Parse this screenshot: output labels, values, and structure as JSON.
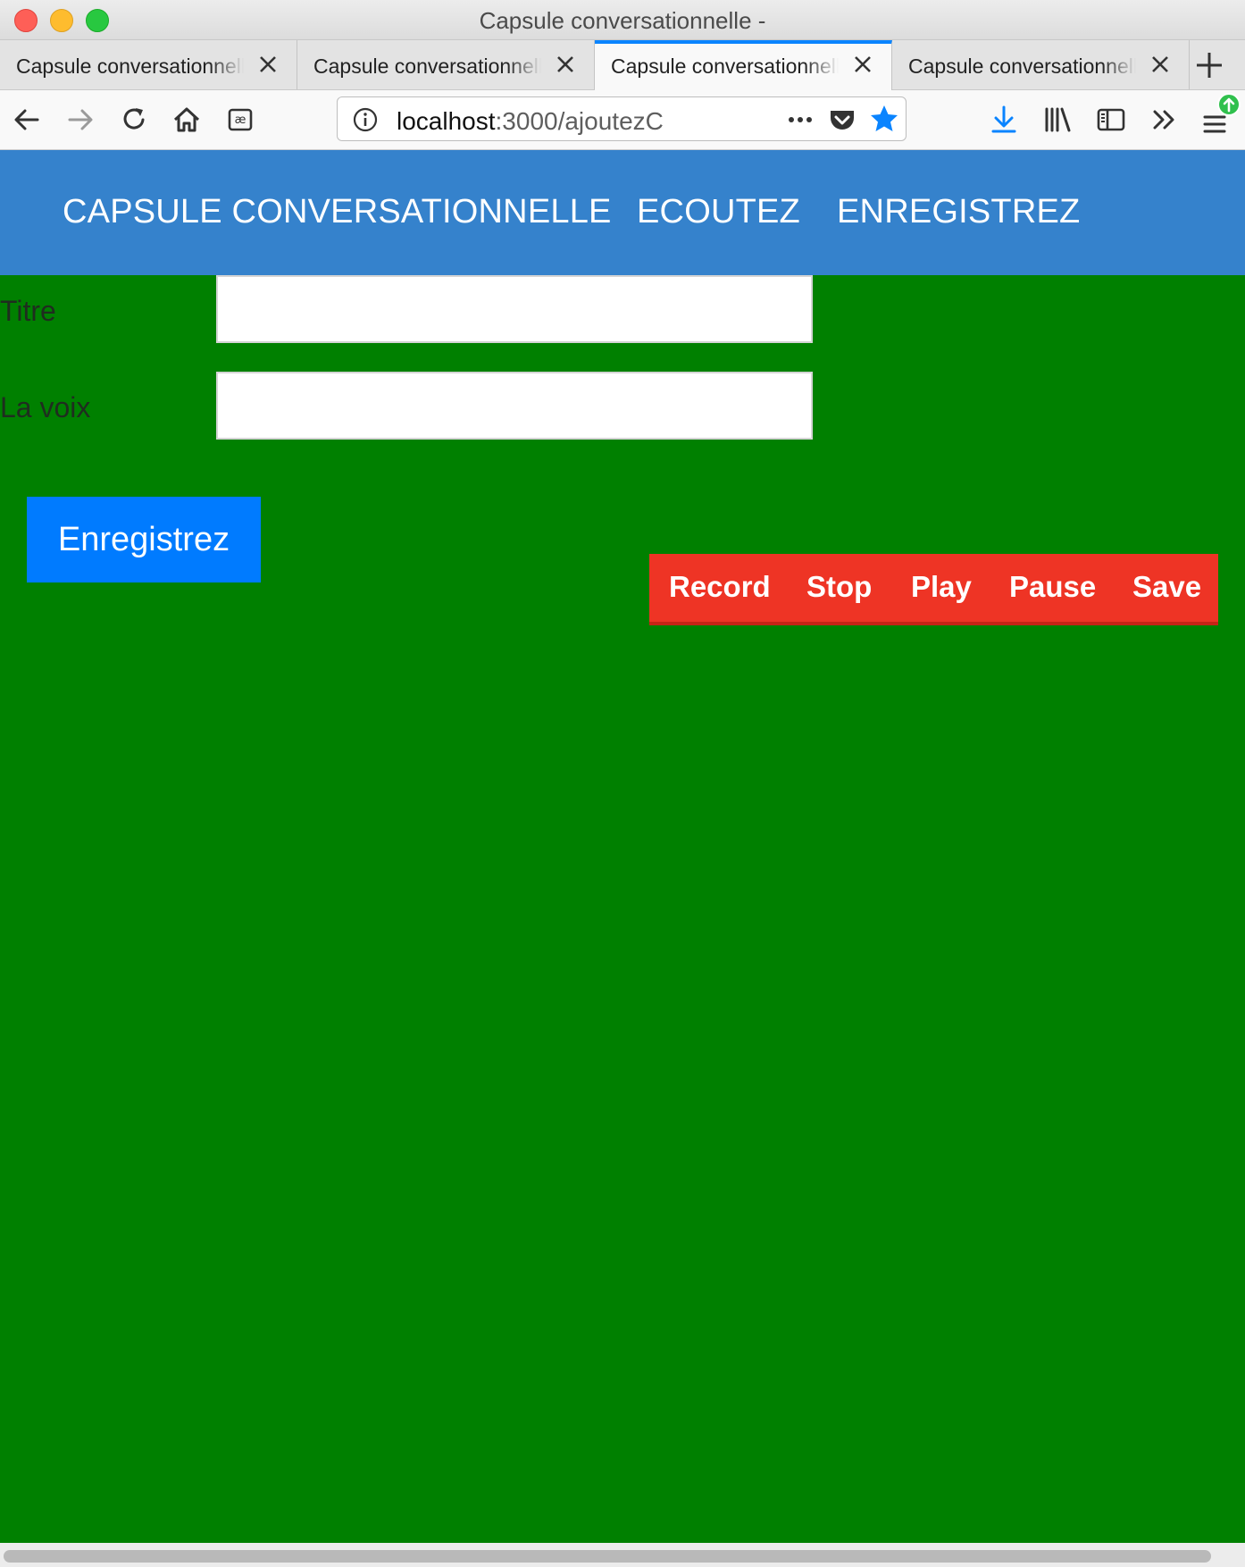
{
  "window": {
    "title": "Capsule conversationnelle -"
  },
  "tabs": [
    {
      "label": "Capsule conversationnelle",
      "active": false
    },
    {
      "label": "Capsule conversationnelle",
      "active": false
    },
    {
      "label": "Capsule conversationnelle",
      "active": true
    },
    {
      "label": "Capsule conversationnelle",
      "active": false
    }
  ],
  "toolbar": {
    "url_host": "localhost",
    "url_path": ":3000/ajoutezC",
    "accent": "#0a84ff"
  },
  "navbar": {
    "brand": "CAPSULE CONVERSATIONNELLE",
    "links": [
      "ECOUTEZ",
      "ENREGISTREZ"
    ],
    "color": "#3582cc"
  },
  "form": {
    "title_label": "Titre",
    "title_value": "",
    "voice_label": "La voix",
    "voice_value": "",
    "submit_label": "Enregistrez",
    "submit_color": "#007bff"
  },
  "recorder": {
    "buttons": [
      "Record",
      "Stop",
      "Play",
      "Pause",
      "Save"
    ],
    "color": "#ee3425"
  },
  "page": {
    "background": "#008000"
  }
}
